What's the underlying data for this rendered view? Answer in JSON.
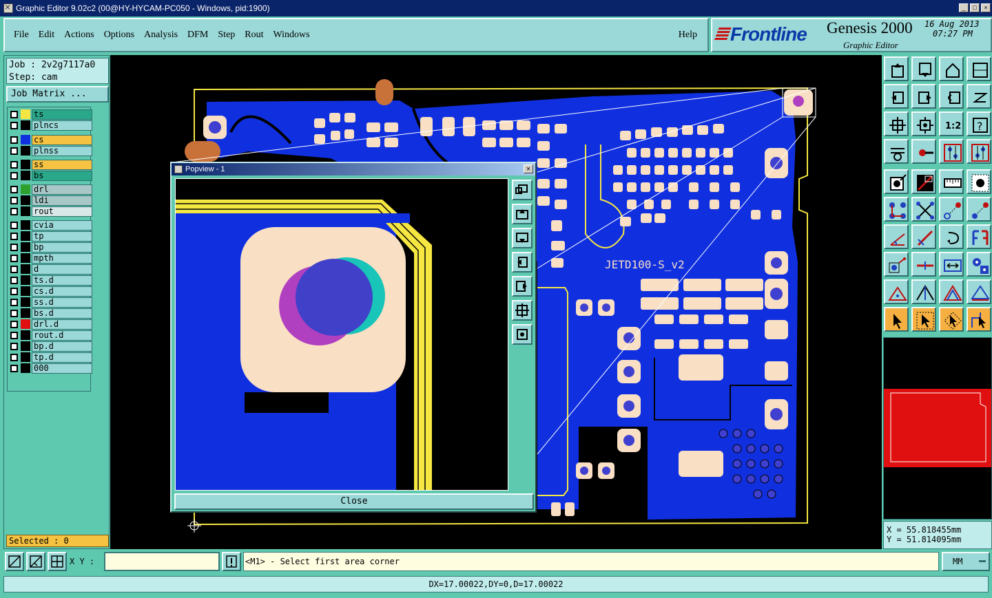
{
  "window": {
    "title": "Graphic Editor 9.02c2 (00@HY-HYCAM-PC050 - Windows, pid:1900)",
    "buttons": [
      "_",
      "□",
      "×"
    ]
  },
  "menu": {
    "items": [
      "File",
      "Edit",
      "Actions",
      "Options",
      "Analysis",
      "DFM",
      "Step",
      "Rout",
      "Windows"
    ],
    "help": "Help"
  },
  "brand": {
    "logo": "Frontline",
    "product": "Genesis 2000",
    "subtitle": "Graphic Editor",
    "date": "16 Aug 2013",
    "time": "07:27 PM"
  },
  "job": {
    "job_line": "Job : 2v2g7117a0",
    "step_line": "Step: cam",
    "matrix_button": "Job Matrix ..."
  },
  "layers": [
    {
      "name": "ts",
      "swatch": "#f5e642",
      "bg": "#2aa88a"
    },
    {
      "name": "plncs",
      "swatch": "#000000",
      "bg": "#9bd8d8"
    },
    {
      "name": "cs",
      "swatch": "#1030e0",
      "bg": "#f5c242"
    },
    {
      "name": "plnss",
      "swatch": "#000000",
      "bg": "#9bd8d8"
    },
    {
      "name": "ss",
      "swatch": "#000000",
      "bg": "#f5c242"
    },
    {
      "name": "bs",
      "swatch": "#000000",
      "bg": "#2aa88a"
    },
    {
      "name": "drl",
      "swatch": "#2ea02e",
      "bg": "#a8c8c8"
    },
    {
      "name": "ldi",
      "swatch": "#000000",
      "bg": "#a8c8c8"
    },
    {
      "name": "rout",
      "swatch": "#000000",
      "bg": "#d8e8e8"
    },
    {
      "name": "cvia",
      "swatch": "#000000",
      "bg": "#9bd8d8"
    },
    {
      "name": "tp",
      "swatch": "#000000",
      "bg": "#9bd8d8"
    },
    {
      "name": "bp",
      "swatch": "#000000",
      "bg": "#9bd8d8"
    },
    {
      "name": "mpth",
      "swatch": "#000000",
      "bg": "#9bd8d8"
    },
    {
      "name": "d",
      "swatch": "#000000",
      "bg": "#9bd8d8"
    },
    {
      "name": "ts.d",
      "swatch": "#000000",
      "bg": "#9bd8d8"
    },
    {
      "name": "cs.d",
      "swatch": "#000000",
      "bg": "#9bd8d8"
    },
    {
      "name": "ss.d",
      "swatch": "#000000",
      "bg": "#9bd8d8"
    },
    {
      "name": "bs.d",
      "swatch": "#000000",
      "bg": "#9bd8d8"
    },
    {
      "name": "drl.d",
      "swatch": "#e01010",
      "bg": "#9bd8d8"
    },
    {
      "name": "rout.d",
      "swatch": "#000000",
      "bg": "#9bd8d8"
    },
    {
      "name": "bp.d",
      "swatch": "#000000",
      "bg": "#9bd8d8"
    },
    {
      "name": "tp.d",
      "swatch": "#000000",
      "bg": "#9bd8d8"
    },
    {
      "name": "000",
      "swatch": "#000000",
      "bg": "#9bd8d8"
    }
  ],
  "selected": "Selected : 0",
  "board": {
    "label": "JETD100-S_v2",
    "colors": {
      "copper": "#1030e0",
      "pad": "#f9dfc4",
      "outline": "#f5e642",
      "drill": "#4040d0"
    }
  },
  "popview": {
    "title": "Popview - 1",
    "close_label": "Close"
  },
  "coords": {
    "x": "X = 55.818455mm",
    "y": "Y = 51.814095mm"
  },
  "bottom": {
    "xy_label": "X Y :",
    "xy_value": "",
    "prompt": "<M1> - Select first area corner",
    "units": "MM",
    "status": "DX=17.00022,DY=0,D=17.00022"
  }
}
